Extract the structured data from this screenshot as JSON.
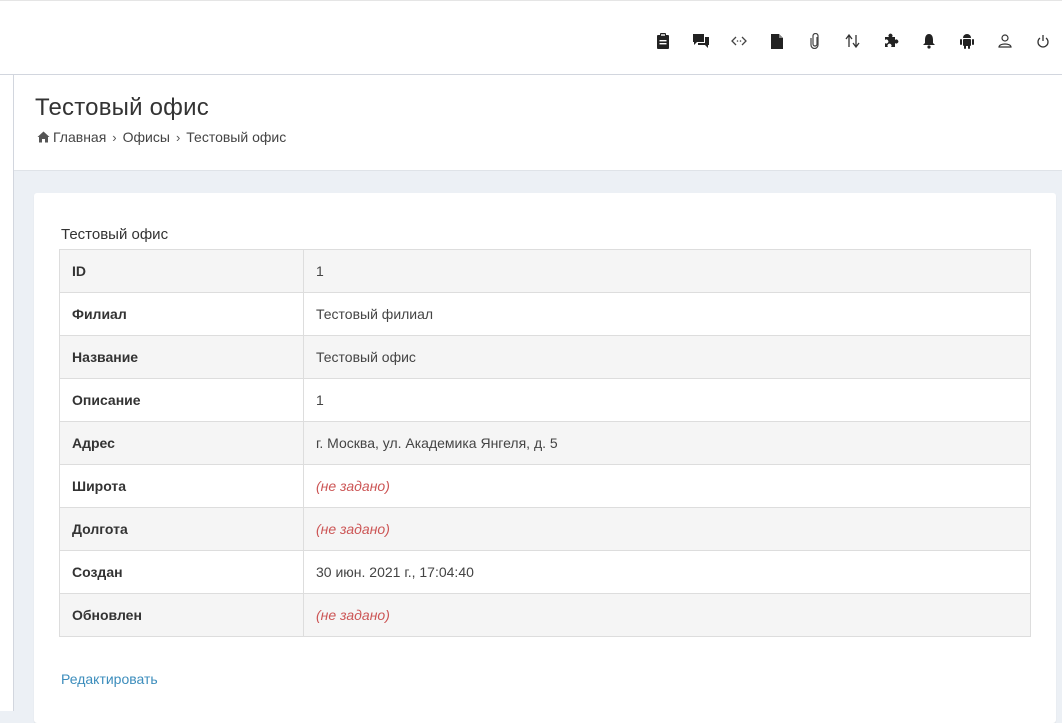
{
  "topnav": {
    "icons": [
      {
        "name": "clipboard-icon"
      },
      {
        "name": "comments-icon"
      },
      {
        "name": "code-arrows-icon"
      },
      {
        "name": "file-icon"
      },
      {
        "name": "paperclip-icon"
      },
      {
        "name": "swap-arrows-icon"
      },
      {
        "name": "puzzle-icon"
      },
      {
        "name": "bell-icon"
      },
      {
        "name": "android-icon"
      },
      {
        "name": "user-icon"
      },
      {
        "name": "power-icon"
      }
    ]
  },
  "header": {
    "title": "Тестовый офис",
    "breadcrumb": {
      "home": "Главная",
      "offices": "Офисы",
      "current": "Тестовый офис",
      "separator": "›"
    }
  },
  "detail": {
    "title": "Тестовый офис",
    "rows": [
      {
        "label": "ID",
        "value": "1",
        "not_set": false
      },
      {
        "label": "Филиал",
        "value": "Тестовый филиал",
        "not_set": false
      },
      {
        "label": "Название",
        "value": "Тестовый офис",
        "not_set": false
      },
      {
        "label": "Описание",
        "value": "1",
        "not_set": false
      },
      {
        "label": "Адрес",
        "value": "г. Москва, ул. Академика Янгеля, д. 5",
        "not_set": false
      },
      {
        "label": "Широта",
        "value": "(не задано)",
        "not_set": true
      },
      {
        "label": "Долгота",
        "value": "(не задано)",
        "not_set": true
      },
      {
        "label": "Создан",
        "value": "30 июн. 2021 г., 17:04:40",
        "not_set": false
      },
      {
        "label": "Обновлен",
        "value": "(не задано)",
        "not_set": true
      }
    ],
    "edit_label": "Редактировать"
  },
  "colors": {
    "link": "#3c8dbc",
    "not_set": "#cc5555",
    "background": "#ecf0f5"
  }
}
